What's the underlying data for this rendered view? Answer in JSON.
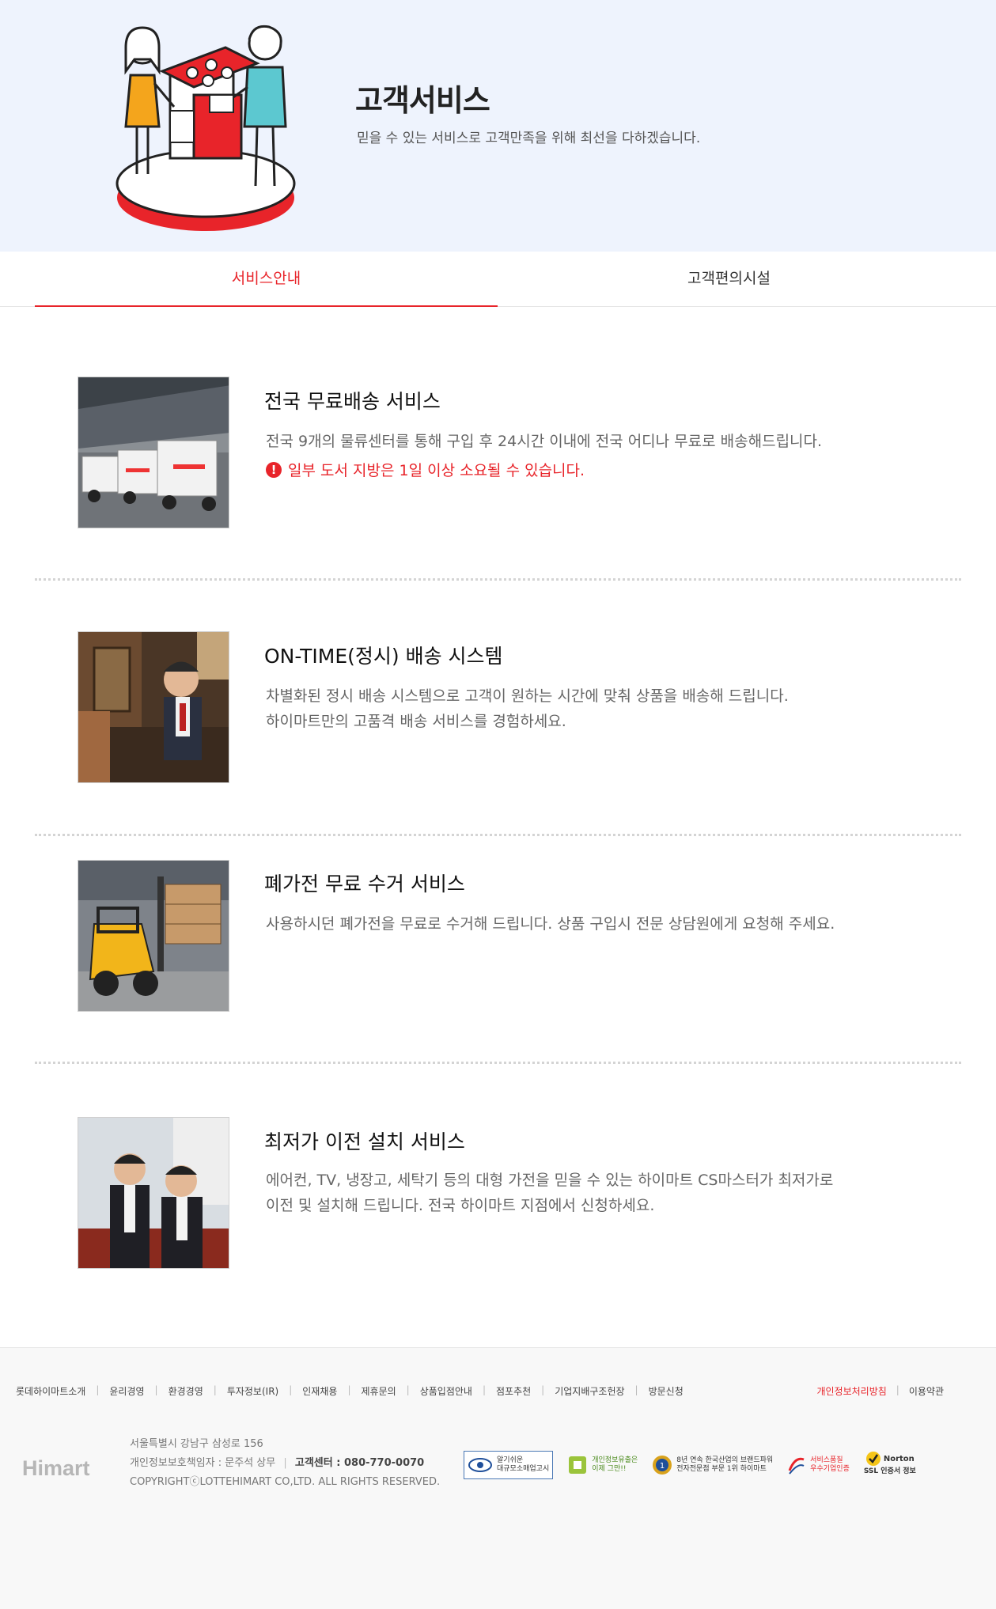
{
  "hero": {
    "title": "고객서비스",
    "subtitle": "믿을 수 있는 서비스로 고객만족을 위해 최선을 다하겠습니다."
  },
  "tabs": [
    {
      "label": "서비스안내",
      "active": true
    },
    {
      "label": "고객편의시설",
      "active": false
    }
  ],
  "services": [
    {
      "title": "전국 무료배송 서비스",
      "desc": [
        "전국 9개의 물류센터를 통해 구입 후 24시간 이내에 전국 어디나 무료로 배송해드립니다."
      ],
      "warning": "일부 도서 지방은 1일 이상 소요될 수 있습니다.",
      "image": "delivery-trucks"
    },
    {
      "title": "ON-TIME(정시) 배송 시스템",
      "desc": [
        "차별화된 정시 배송 시스템으로 고객이 원하는 시간에 맞춰 상품을 배송해 드립니다.",
        "하이마트만의 고품격 배송 서비스를 경험하세요."
      ],
      "image": "delivery-staff"
    },
    {
      "title": "폐가전 무료 수거 서비스",
      "desc": [
        "사용하시던 폐가전을 무료로 수거해 드립니다. 상품 구입시 전문 상담원에게 요청해 주세요."
      ],
      "image": "forklift"
    },
    {
      "title": "최저가 이전 설치 서비스",
      "desc": [
        "에어컨, TV, 냉장고, 세탁기 등의 대형 가전을 믿을 수 있는 하이마트 CS마스터가 최저가로",
        "이전 및 설치해 드립니다. 전국 하이마트 지점에서 신청하세요."
      ],
      "image": "cs-masters"
    }
  ],
  "footer": {
    "links": [
      "롯데하이마트소개",
      "윤리경영",
      "환경경영",
      "투자정보(IR)",
      "인재채용",
      "제휴문의",
      "상품입점안내",
      "점포추천",
      "기업지배구조헌장",
      "방문신청"
    ],
    "privacy": "개인정보처리방침",
    "terms": "이용약관",
    "logo": "Himart",
    "address": "서울특별시 강남구 삼성로 156",
    "officer": "개인정보보호책임자 : 문주석 상무",
    "center_label": "고객센터 : 080-770-0070",
    "copyright": "COPYRIGHTⓒLOTTEHIMART CO,LTD. ALL RIGHTS RESERVED.",
    "badges": [
      {
        "line1": "알기쉬운",
        "line2": "대규모소매업고시"
      },
      {
        "line1": "개인정보유출은",
        "line2": "이제 그만!!"
      },
      {
        "line1": "8년 연속 한국산업의 브랜드파워",
        "line2": "전자전문점 부문 1위 하이마트"
      },
      {
        "line1": "서비스품질",
        "line2": "우수기업인증"
      },
      {
        "line1": "Norton",
        "line2": "SSL 인증서 정보"
      }
    ]
  },
  "colors": {
    "accent": "#e8242a",
    "hero_bg": "#eef3fd"
  }
}
